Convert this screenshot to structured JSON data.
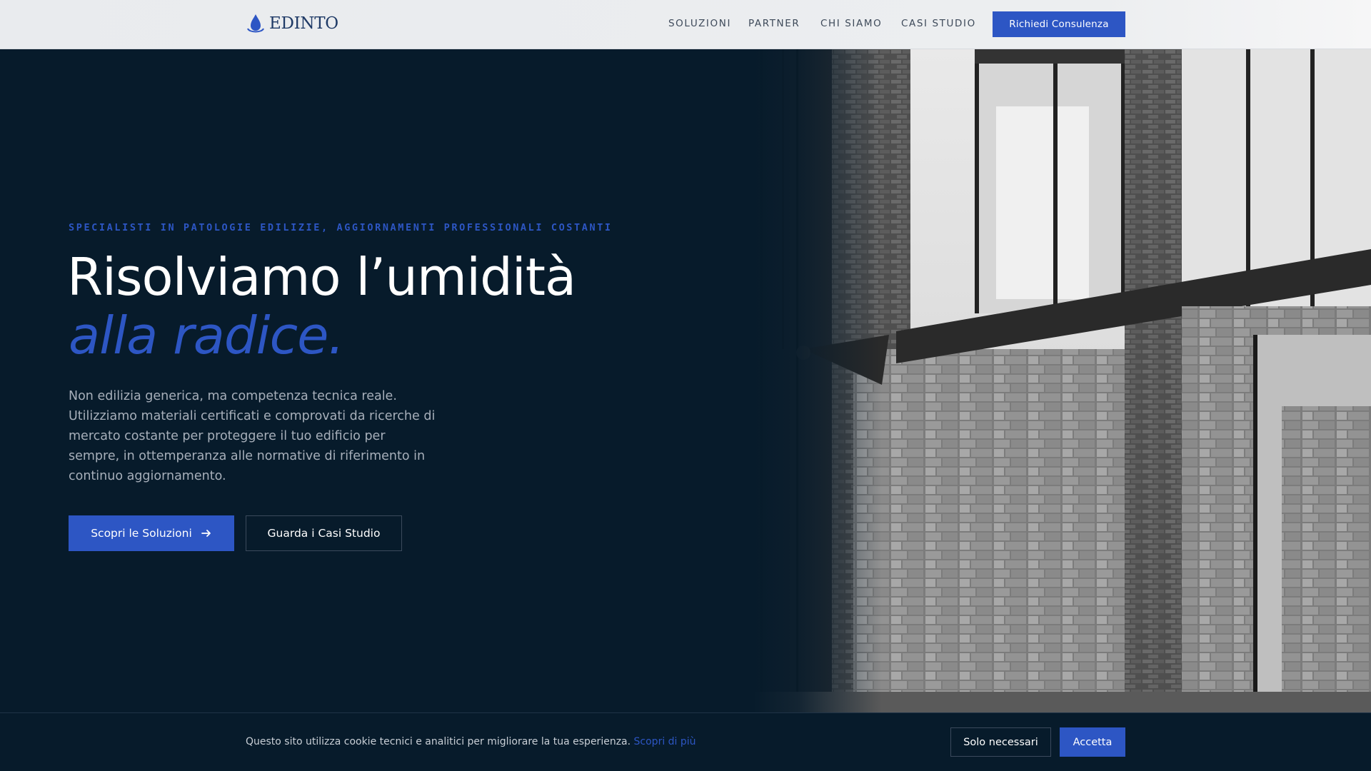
{
  "header": {
    "logo_text": "EDINTO",
    "logo_icon": "water-drop-icon",
    "nav": [
      {
        "label": "SOLUZIONI"
      },
      {
        "label": "PARTNER"
      },
      {
        "label": "CHI SIAMO"
      },
      {
        "label": "CASI STUDIO"
      }
    ],
    "cta_label": "Richiedi Consulenza"
  },
  "hero": {
    "eyebrow": "SPECIALISTI IN PATOLOGIE EDILIZIE, AGGIORNAMENTI PROFESSIONALI COSTANTI",
    "title_line1": "Risolviamo l’umidità",
    "title_line2": "alla radice.",
    "description": "Non edilizia generica, ma competenza tecnica reale. Utilizziamo materiali certificati e comprovati da ricerche di mercato costante per proteggere il tuo edificio per sempre, in ottemperanza alle normative di riferimento in continuo aggiornamento.",
    "primary_button": "Scopri le Soluzioni",
    "primary_button_icon": "arrow-right-icon",
    "secondary_button": "Guarda i Casi Studio"
  },
  "cookie_bar": {
    "text": "Questo sito utilizza cookie tecnici e analitici per migliorare la tua esperienza.",
    "link": "Scopri di più",
    "necessary_button": "Solo necessari",
    "accept_button": "Accetta"
  },
  "colors": {
    "accent": "#2d56c4",
    "background": "#071b2b",
    "header_bg": "#eceef0",
    "text_muted": "#a7afba"
  }
}
